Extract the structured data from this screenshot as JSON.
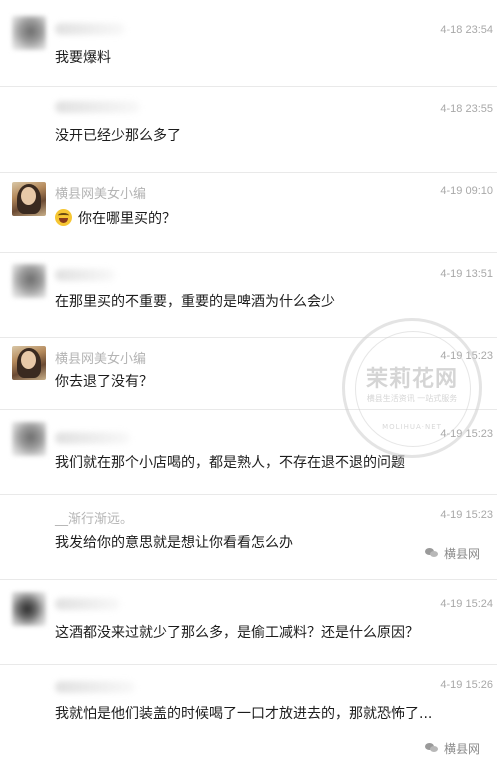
{
  "messages": [
    {
      "id": 1,
      "avatar": "blurred-avatar",
      "name": "",
      "time": "4-18 23:54",
      "text": "我要爆料"
    },
    {
      "id": 2,
      "avatar": "blurred-avatar",
      "name": "",
      "time": "4-18 23:55",
      "text": "没开已经少那么多了"
    },
    {
      "id": 3,
      "avatar": "photo-avatar",
      "name": "横县网美女小编",
      "time": "4-19 09:10",
      "emoji": "laugh-cry-emoji",
      "text": "你在哪里买的？"
    },
    {
      "id": 4,
      "avatar": "blurred-avatar",
      "name": "",
      "time": "4-19 13:51",
      "text": "在那里买的不重要，重要的是啤酒为什么会少"
    },
    {
      "id": 5,
      "avatar": "photo-avatar",
      "name": "横县网美女小编",
      "time": "4-19 15:23",
      "text": "你去退了没有？"
    },
    {
      "id": 6,
      "avatar": "blurred-avatar",
      "name": "",
      "time": "4-19 15:23",
      "text": "我们就在那个小店喝的，都是熟人，不存在退不退的问题"
    },
    {
      "id": 7,
      "avatar": "none",
      "name": "__渐行渐远。",
      "time": "4-19 15:23",
      "text": "我发给你的意思就是想让你看看怎么办"
    },
    {
      "id": 8,
      "avatar": "blurred-avatar-dark",
      "name": "",
      "time": "4-19 15:24",
      "text": "这酒都没来过就少了那么多，是偷工减料？还是什么原因？"
    },
    {
      "id": 9,
      "avatar": "none",
      "name": "",
      "time": "4-19 15:26",
      "text": "我就怕是他们装盖的时候喝了一口才放进去的，那就恐怖了..."
    }
  ],
  "watermark": {
    "brand": "茉莉花网",
    "subtitle": "横县生活资讯 一站式服务",
    "subtitle2": "MOLIHUA·NET"
  },
  "source_tags": [
    {
      "icon": "wechat-icon",
      "label": "横县网"
    },
    {
      "icon": "wechat-icon",
      "label": "横县网"
    }
  ]
}
